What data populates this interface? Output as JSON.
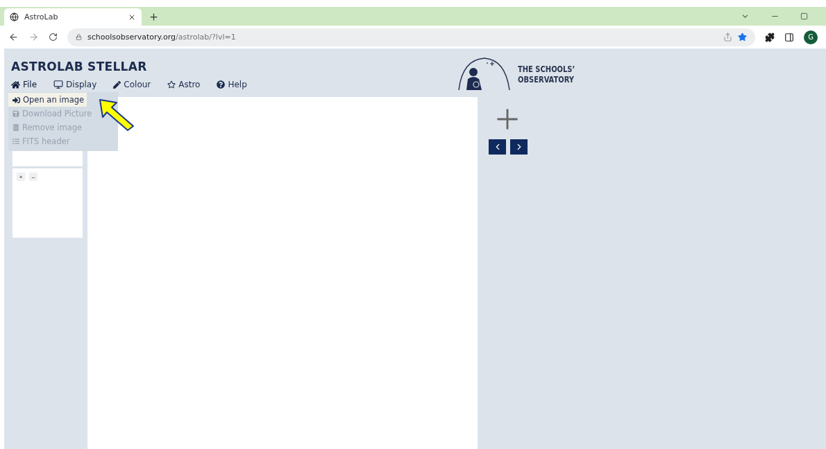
{
  "browser": {
    "tab_title": "AstroLab",
    "url_domain": "schoolsobservatory.org",
    "url_path": "/astrolab/?lvl=1",
    "profile_initial": "G"
  },
  "app": {
    "title": "ASTROLAB STELLAR"
  },
  "menu": [
    {
      "kind": "file",
      "label": "File",
      "expanded": true
    },
    {
      "kind": "display",
      "label": "Display",
      "expanded": false
    },
    {
      "kind": "colour",
      "label": "Colour",
      "expanded": false
    },
    {
      "kind": "astro",
      "label": "Astro",
      "expanded": false
    },
    {
      "kind": "help",
      "label": "Help",
      "expanded": false
    }
  ],
  "file_menu": [
    {
      "kind": "open",
      "label": "Open an image",
      "disabled": false,
      "highlighted": true
    },
    {
      "kind": "download",
      "label": "Download Picture",
      "disabled": true,
      "highlighted": false
    },
    {
      "kind": "remove",
      "label": "Remove image",
      "disabled": true,
      "highlighted": false
    },
    {
      "kind": "fits",
      "label": "FITS header",
      "disabled": true,
      "highlighted": false
    }
  ],
  "zoom_buttons": [
    "+",
    "–"
  ],
  "logo": {
    "line_1": "THE SCHOOLS’",
    "line_2": "OBSERVATORY"
  }
}
